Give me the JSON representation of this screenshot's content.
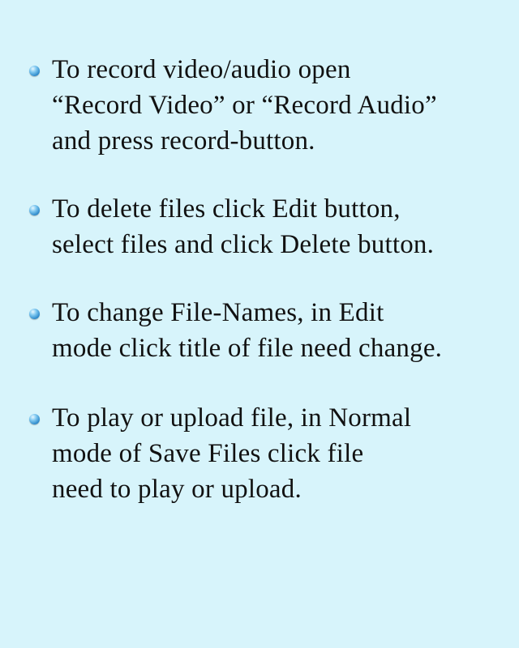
{
  "instructions": [
    {
      "lines": [
        "To record video/audio open",
        "“Record Video” or “Record Audio”",
        "and press record-button."
      ]
    },
    {
      "lines": [
        "To delete files click Edit button,",
        "select files and click Delete button."
      ]
    },
    {
      "lines": [
        "To change File-Names, in Edit",
        "mode click title of file need change."
      ]
    },
    {
      "lines": [
        "To play or upload file, in Normal",
        "mode of Save Files click file",
        "need to play or upload."
      ]
    }
  ],
  "icons": {
    "bullet": "bullet-dot-icon"
  },
  "colors": {
    "background": "#d7f4fb",
    "text": "#111111",
    "bullet": "#2a86c8"
  }
}
